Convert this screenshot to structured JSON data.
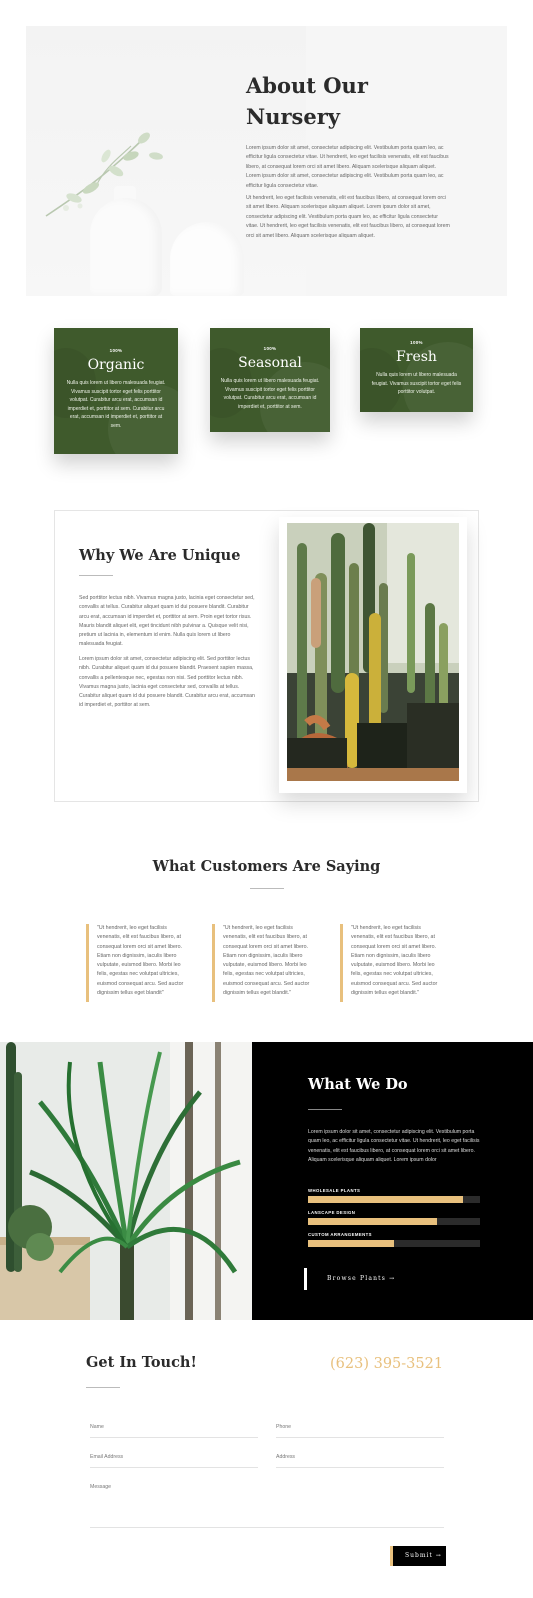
{
  "about": {
    "title_line1": "About Our",
    "title_line2": "Nursery",
    "p1": "Lorem ipsum dolor sit amet, consectetur adipiscing elit. Vestibulum porta quam leo, ac efficitur ligula consectetur vitae. Ut hendrerit, leo eget facilisis venenatis, elit est faucibus libero, at consequat lorem orci sit amet libero. Aliquam scelerisque aliquam aliquet.  Lorem ipsum dolor sit amet, consectetur adipiscing elit. Vestibulum porta quam leo, ac efficitur ligula consectetur vitae.",
    "p2": "Ut hendrerit, leo eget facilisis venenatis, elit est faucibus libero, at consequat lorem orci sit amet libero. Aliquam scelerisque aliquam aliquet. Lorem ipsum dolor sit amet, consectetur adipiscing elit. Vestibulum porta quam leo, ac efficitur ligula consectetur vitae. Ut hendrerit, leo eget facilisis venenatis, elit est faucibus libero, at consequat lorem orci sit amet libero. Aliquam scelerisque aliquam aliquet."
  },
  "cards": [
    {
      "pct": "100%",
      "title": "Organic",
      "text": "Nulla quis lorem ut libero malesuada feugiat. Vivamus suscipit tortor eget felis porttitor volutpat. Curabitur arcu erat, accumsan id imperdiet et, porttitor at sem. Curabitur arcu erat, accumsan id imperdiet et, porttitor at sem."
    },
    {
      "pct": "100%",
      "title": "Seasonal",
      "text": "Nulla quis lorem ut libero malesuada feugiat. Vivamus suscipit tortor eget felis porttitor volutpat. Curabitur arcu erat, accumsan id imperdiet et, porttitor at sem."
    },
    {
      "pct": "100%",
      "title": "Fresh",
      "text": "Nulla quis lorem ut libero malesuada feugiat. Vivamus suscipit tortor eget felis porttitor volutpat."
    }
  ],
  "unique": {
    "title": "Why We Are Unique",
    "p1": "Sed porttitor lectus nibh. Vivamus magna justo, lacinia eget consectetur sed, convallis at tellus. Curabitur aliquet quam id dui posuere blandit. Curabitur arcu erat, accumsan id imperdiet et, porttitor at sem. Proin eget tortor risus. Mauris blandit aliquet elit, eget tincidunt nibh pulvinar a. Quisque velit nisi, pretium ut lacinia in, elementum id enim. Nulla quis lorem ut libero malesuada feugiat.",
    "p2": "Lorem ipsum dolor sit amet, consectetur adipiscing elit. Sed porttitor lectus nibh. Curabitur aliquet quam id dui posuere blandit. Praesent sapien massa, convallis a pellentesque nec, egestas non nisi. Sed porttitor lectus nibh. Vivamus magna justo, lacinia eget consectetur sed, convallis at tellus. Curabitur aliquet quam id dui posuere blandit. Curabitur arcu erat, accumsan id imperdiet et, porttitor at sem."
  },
  "testimonials": {
    "title": "What Customers Are Saying",
    "quotes": [
      "\"Ut hendrerit, leo eget facilisis venenatis, elit est faucibus libero, at consequat lorem orci sit amet libero. Etiam non dignissim, iaculis libero vulputate, euismod libero. Morbi leo felis, egestas nec volutpat ultricies, euismod consequat arcu. Sed auctor dignissim tellus eget blandit\"",
      "\"Ut hendrerit, leo eget facilisis venenatis, elit est faucibus libero, at consequat lorem orci sit amet libero. Etiam non dignissim, iaculis libero vulputate, euismod libero. Morbi leo felis, egestas nec volutpat ultricies, euismod consequat arcu. Sed auctor dignissim tellus eget blandit.\"",
      "\"Ut hendrerit, leo eget facilisis venenatis, elit est faucibus libero, at consequat lorem orci sit amet libero. Etiam non dignissim, iaculis libero vulputate, euismod libero. Morbi leo felis, egestas nec volutpat ultricies, euismod consequat arcu. Sed auctor dignissim tellus eget blandit.\""
    ]
  },
  "wwd": {
    "title": "What We Do",
    "text": "Lorem ipsum dolor sit amet, consectetur adipiscing elit. Vestibulum porta quam leo, ac efficitur ligula consectetur vitae. Ut hendrerit, leo eget facilisis venenatis, elit est faucibus libero, at consequat lorem orci sit amet libero. Aliquam scelerisque aliquam aliquet. Lorem ipsum dolor",
    "bars": [
      {
        "label": "WHOLESALE PLANTS",
        "value": 0.9
      },
      {
        "label": "LANSCAPE DESIGN",
        "value": 0.75
      },
      {
        "label": "CUSTOM ARRANGEMENTS",
        "value": 0.5
      }
    ],
    "button": "Browse Plants →"
  },
  "contact": {
    "title": "Get In Touch!",
    "phone": "(623) 395-3521",
    "name_ph": "Name",
    "phone_ph": "Phone",
    "email_ph": "Email Address",
    "address_ph": "Address",
    "message_ph": "Message",
    "submit": "Submit →"
  },
  "colors": {
    "accent": "#e8c07d",
    "green": "#3f5a2c",
    "dark": "#000000"
  }
}
